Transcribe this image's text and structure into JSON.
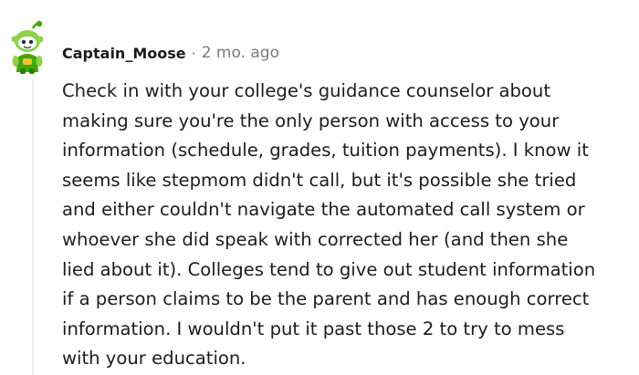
{
  "comment": {
    "username": "Captain_Moose",
    "separator": "·",
    "timestamp": "2 mo. ago",
    "body_lines": [
      "Check in with your college's guidance counselor about",
      "making sure you're the only person with access to your",
      "information (schedule, grades, tuition payments). I know it",
      "seems like stepmom didn't call, but it's possible she tried",
      "and either couldn't navigate the automated call system or",
      "whoever she did speak with corrected her (and then she",
      "lied about it). Colleges tend to give out student information",
      "if a person claims to be the parent and has enough correct",
      "information. I wouldn't put it past those 2 to try to mess",
      "with your education."
    ]
  },
  "avatar": {
    "icon": "snoo-avatar-icon",
    "colors": {
      "body": "#46a508",
      "head": "#8fd14f",
      "visor": "#ffffff",
      "eye": "#2e2e2e",
      "accent": "#f2c230",
      "antenna": "#46a508"
    }
  },
  "theme": {
    "thread_line": "#edeff1",
    "text": "#1c1c1c",
    "muted": "#7c7c7c"
  }
}
